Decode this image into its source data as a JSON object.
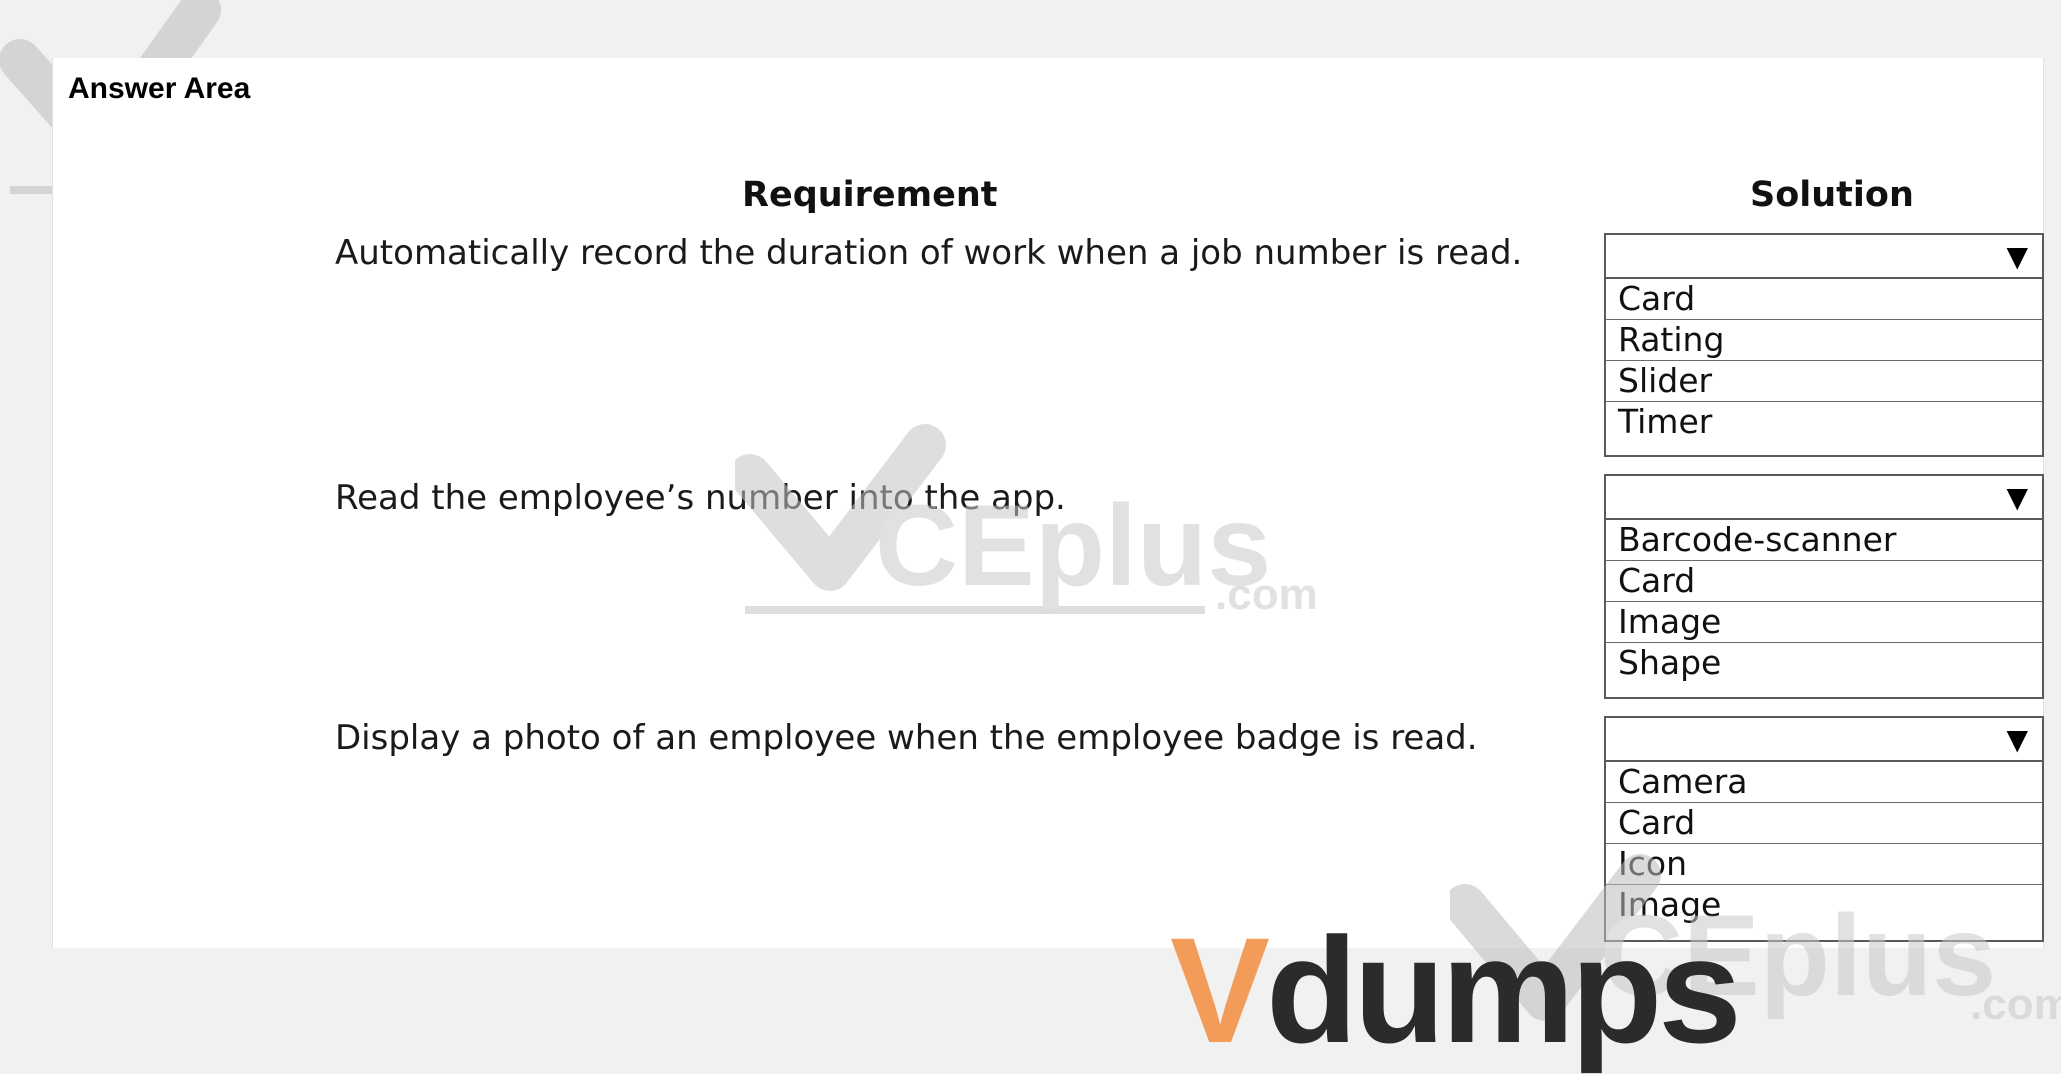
{
  "answer_area_label": "Answer Area",
  "headers": {
    "requirement": "Requirement",
    "solution": "Solution"
  },
  "rows": [
    {
      "requirement": "Automatically record the duration of work when a job number is read.",
      "dropdown": {
        "selected": "",
        "options": [
          "Card",
          "Rating",
          "Slider",
          "Timer"
        ]
      }
    },
    {
      "requirement": "Read the employee’s number into the app.",
      "dropdown": {
        "selected": "",
        "options": [
          "Barcode-scanner",
          "Card",
          "Image",
          "Shape"
        ]
      }
    },
    {
      "requirement": "Display a photo of an employee when the employee badge is read.",
      "dropdown": {
        "selected": "",
        "options": [
          "Camera",
          "Card",
          "Icon",
          "Image"
        ]
      }
    }
  ],
  "dropdown_arrow_icon": "triangle-down-icon",
  "watermarks": {
    "vceplus_text": "CEplus",
    "vceplus_domain": ".com",
    "udumps_mark": "V",
    "udumps_text": "dumps"
  },
  "colors": {
    "udumps_mark": "#f39c5a",
    "watermark_gray": "#c9c9c9"
  }
}
